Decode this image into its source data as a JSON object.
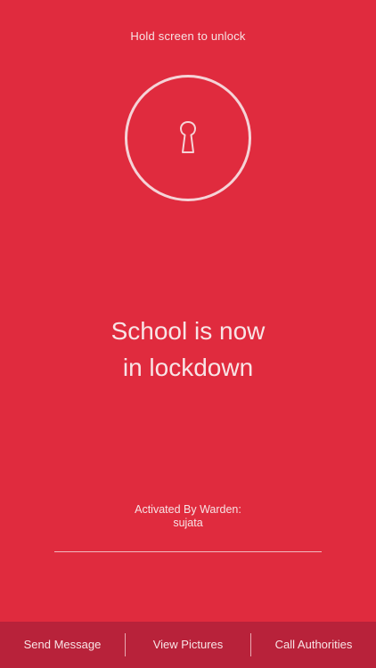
{
  "hint": "Hold screen to unlock",
  "lock": {
    "icon": "keyhole-icon"
  },
  "headline": {
    "line1": "School is now",
    "line2": "in lockdown"
  },
  "activated": {
    "label": "Activated By Warden:",
    "name": "sujata"
  },
  "bottom_bar": {
    "send_message": "Send Message",
    "view_pictures": "View Pictures",
    "call_authorities": "Call Authorities"
  },
  "colors": {
    "background": "#E02B3E",
    "bottom_bar": "#B8223A"
  }
}
